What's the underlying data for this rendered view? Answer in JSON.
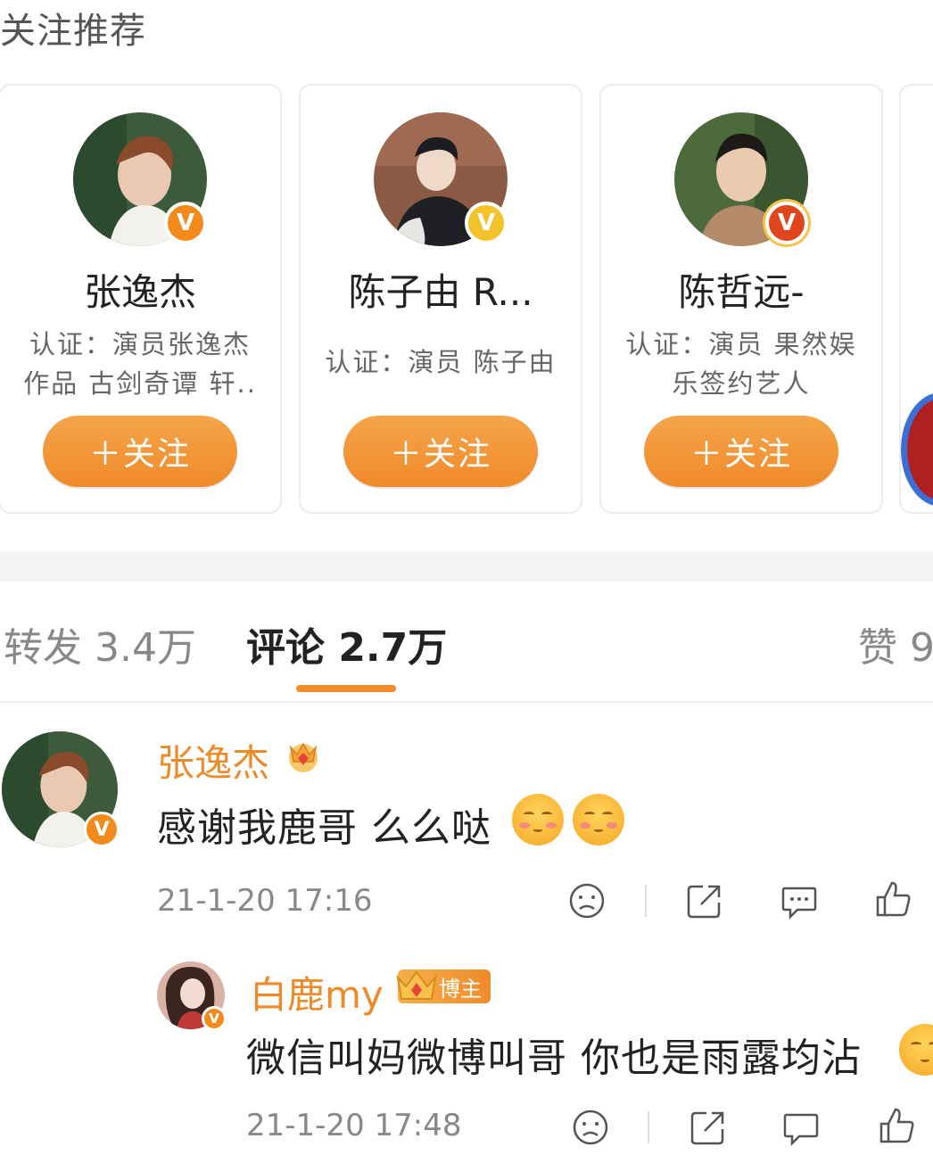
{
  "recommend": {
    "title": "关注推荐",
    "cards": [
      {
        "name": "张逸杰",
        "desc_line1": "认证：演员张逸杰",
        "desc_line2": "作品 古剑奇谭 轩..",
        "follow_label": "＋关注",
        "badge": "V"
      },
      {
        "name": "陈子由 R...",
        "desc_line1": "认证：演员 陈子由",
        "desc_line2": "",
        "follow_label": "＋关注",
        "badge": "V"
      },
      {
        "name": "陈哲远-",
        "desc_line1": "认证：演员 果然娱",
        "desc_line2": "乐签约艺人",
        "follow_label": "＋关注",
        "badge": "V"
      }
    ]
  },
  "tabs": {
    "repost": "转发 3.4万",
    "comment": "评论 2.7万",
    "like": "赞 9"
  },
  "comments": [
    {
      "user": "张逸杰",
      "text": "感谢我鹿哥 么么哒",
      "time": "21-1-20 17:16",
      "badge": "V"
    },
    {
      "user": "白鹿my",
      "host_label": "博主",
      "text": "微信叫妈微博叫哥 你也是雨露均沾",
      "time": "21-1-20 17:48",
      "badge": "V"
    }
  ],
  "colors": {
    "accent": "#ef8a2a",
    "name_orange": "#ef8a2a",
    "text_dark": "#222222",
    "text_gray": "#888888"
  }
}
